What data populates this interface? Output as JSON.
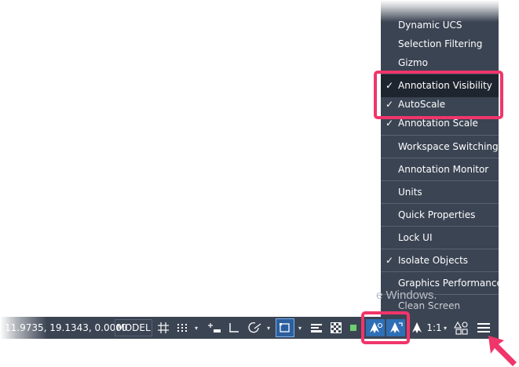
{
  "menu": {
    "items": [
      {
        "label": "Dynamic UCS",
        "checked": false
      },
      {
        "label": "Selection Filtering",
        "checked": false
      },
      {
        "label": "Gizmo",
        "checked": false
      },
      {
        "label": "Annotation Visibility",
        "checked": true
      },
      {
        "label": "AutoScale",
        "checked": true
      },
      {
        "label": "Annotation Scale",
        "checked": true
      },
      {
        "label": "Workspace Switching",
        "checked": false
      },
      {
        "label": "Annotation Monitor",
        "checked": false
      },
      {
        "label": "Units",
        "checked": false
      },
      {
        "label": "Quick Properties",
        "checked": false
      },
      {
        "label": "Lock UI",
        "checked": false
      },
      {
        "label": "Isolate Objects",
        "checked": true
      },
      {
        "label": "Graphics Performance",
        "checked": false
      },
      {
        "label": "Clean Screen",
        "checked": false
      }
    ],
    "checkmark": "✓"
  },
  "watermark": "e Windows.",
  "statusbar": {
    "coordinates": "11.9735, 19.1343, 0.0000",
    "model_label": "MODEL",
    "scale_label": "1:1",
    "dropdown_glyph": "▾"
  },
  "colors": {
    "bar_bg": "#3b4453",
    "highlight": "#f0356b",
    "active_blue": "#2e6fb6",
    "arrow": "#f0356b"
  }
}
